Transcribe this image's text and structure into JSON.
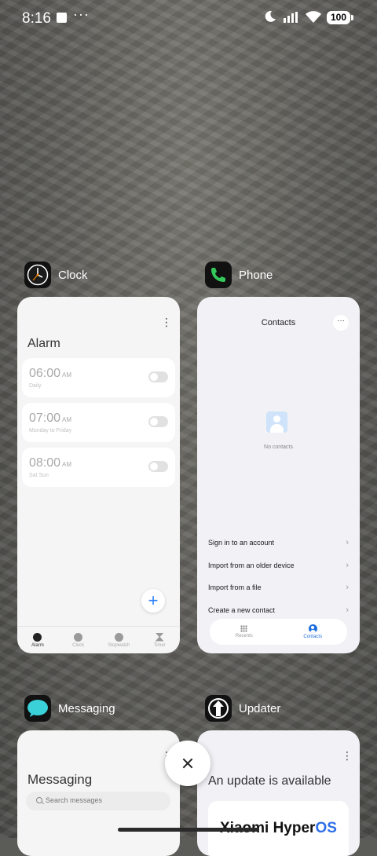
{
  "status_bar": {
    "time": "8:16",
    "overflow_indicator": "···",
    "battery_level": "100"
  },
  "apps": {
    "clock": {
      "name": "Clock",
      "icon": "clock-icon",
      "screen_title": "Alarm",
      "alarms": [
        {
          "time": "06:00",
          "ampm": "AM",
          "repeat": "Daily",
          "enabled": false
        },
        {
          "time": "07:00",
          "ampm": "AM",
          "repeat": "Monday to Friday",
          "enabled": false
        },
        {
          "time": "08:00",
          "ampm": "AM",
          "repeat": "Sat Sun",
          "enabled": false
        }
      ],
      "add_label": "+",
      "nav": [
        {
          "label": "Alarm",
          "active": true
        },
        {
          "label": "Clock",
          "active": false
        },
        {
          "label": "Stopwatch",
          "active": false
        },
        {
          "label": "Timer",
          "active": false
        }
      ]
    },
    "phone": {
      "name": "Phone",
      "icon": "phone-icon",
      "screen_title": "Contacts",
      "empty_text": "No contacts",
      "actions": [
        "Sign in to an account",
        "Import from an older device",
        "Import from a file",
        "Create a new contact"
      ],
      "nav": [
        {
          "label": "Recents",
          "active": false
        },
        {
          "label": "Contacts",
          "active": true
        }
      ]
    },
    "messaging": {
      "name": "Messaging",
      "icon": "messaging-icon",
      "screen_title": "Messaging",
      "search_placeholder": "Search messages"
    },
    "updater": {
      "name": "Updater",
      "icon": "updater-icon",
      "screen_title": "An update is available",
      "brand_prefix": "Xiaomi Hyper",
      "brand_suffix": "OS"
    }
  },
  "colors": {
    "accent": "#1f6fde",
    "clock_fab": "#2f83f7",
    "messaging_icon": "#3ad1d8",
    "phone_icon": "#34c759",
    "hyperos_blue": "#2f6fe8"
  }
}
